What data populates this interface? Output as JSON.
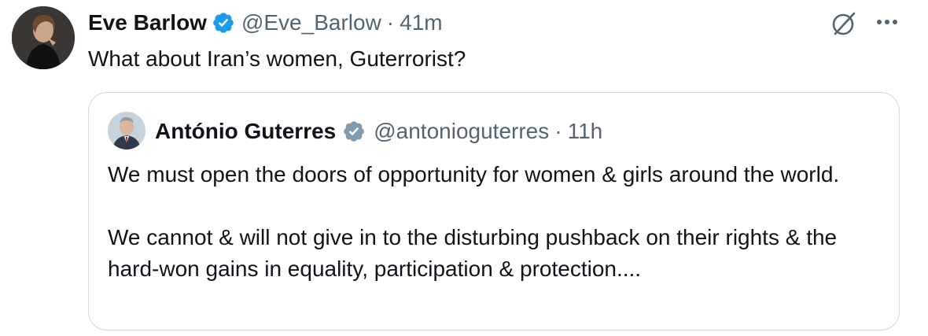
{
  "tweet": {
    "author_name": "Eve Barlow",
    "handle": "@Eve_Barlow",
    "separator": "·",
    "time": "41m",
    "text": "What about Iran’s women, Guterrorist?",
    "verified_badge_color": "#1d9bf0",
    "actions": {
      "grok_icon": "grok-icon",
      "more_icon": "more-options-icon"
    }
  },
  "quoted_tweet": {
    "author_name": "António Guterres",
    "handle": "@antonioguterres",
    "separator": "·",
    "time": "11h",
    "verified_badge_color": "#829aab",
    "paragraphs": [
      "We must open the doors of opportunity for women & girls around the world.",
      "We cannot & will not give in to the disturbing pushback on their rights & the hard-won gains in equality, participation & protection...."
    ]
  },
  "colors": {
    "text_primary": "#0f1419",
    "text_secondary": "#536471",
    "border": "#cfd9de"
  }
}
